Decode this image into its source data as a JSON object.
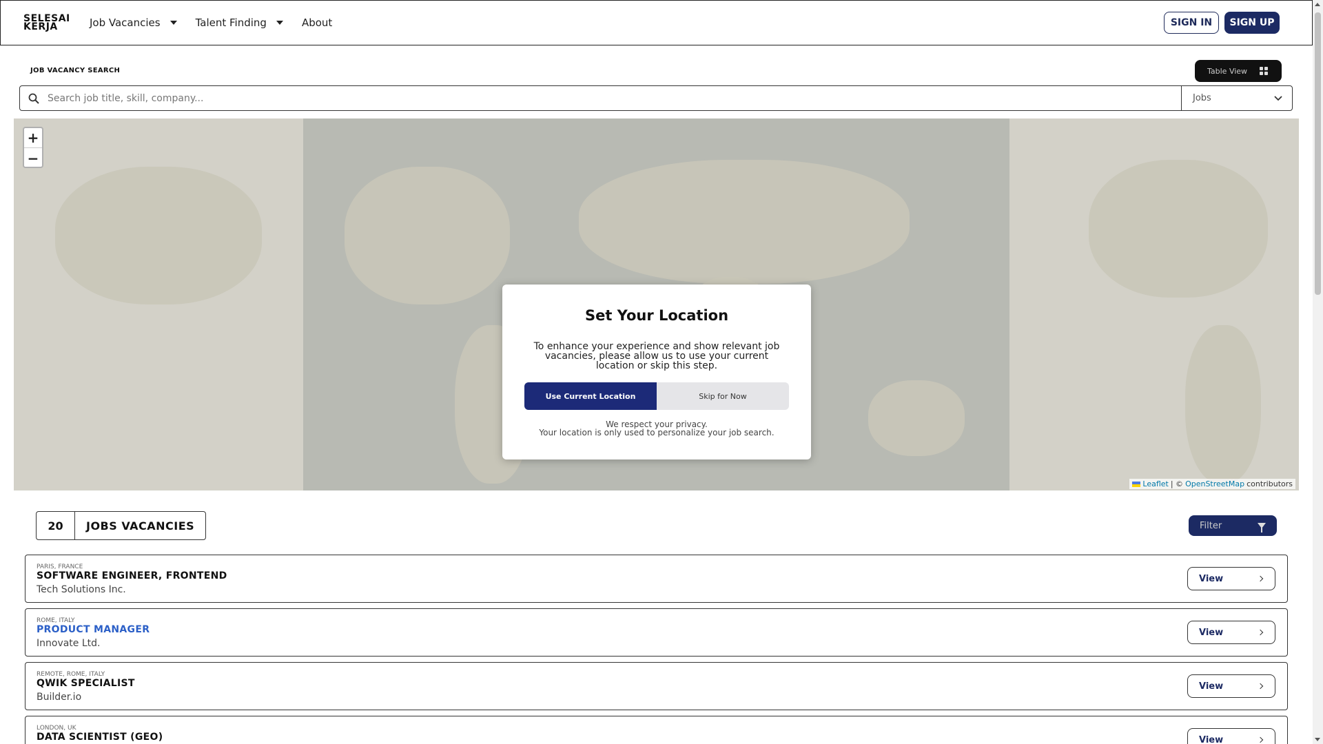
{
  "header": {
    "logo_line1": "SELESAI",
    "logo_line2": "KERJA",
    "nav": [
      {
        "label": "Job Vacancies",
        "dropdown": true
      },
      {
        "label": "Talent Finding",
        "dropdown": true
      },
      {
        "label": "About",
        "dropdown": false
      }
    ],
    "signin_label": "SIGN IN",
    "signup_label": "SIGN UP"
  },
  "search": {
    "section_title": "JOB VACANCY SEARCH",
    "table_view_label": "Table View",
    "placeholder": "Search job title, skill, company...",
    "category_value": "Jobs"
  },
  "map": {
    "zoom_in": "+",
    "zoom_out": "−",
    "attribution_leaflet": "Leaflet",
    "attribution_sep": "| ©",
    "attribution_osm": "OpenStreetMap",
    "attribution_suffix": "contributors"
  },
  "modal": {
    "title": "Set Your Location",
    "description": "To enhance your experience and show relevant job vacancies, please allow us to use your current location or skip this step.",
    "use_location_label": "Use Current Location",
    "skip_label": "Skip for Now",
    "privacy_line1": "We respect your privacy.",
    "privacy_line2": "Your location is only used to personalize your job search."
  },
  "results": {
    "count": "20",
    "label": "JOBS VACANCIES",
    "filter_label": "Filter"
  },
  "jobs": [
    {
      "location": "PARIS, FRANCE",
      "title": "SOFTWARE ENGINEER, FRONTEND",
      "company": "Tech Solutions Inc.",
      "view_label": "View",
      "title_color": "#111111"
    },
    {
      "location": "ROME, ITALY",
      "title": "PRODUCT MANAGER",
      "company": "Innovate Ltd.",
      "view_label": "View",
      "title_color": "#2b5fc7"
    },
    {
      "location": "REMOTE, ROME, ITALY",
      "title": "QWIK SPECIALIST",
      "company": "Builder.io",
      "view_label": "View",
      "title_color": "#111111"
    },
    {
      "location": "LONDON, UK",
      "title": "DATA SCIENTIST (GEO)",
      "company": "",
      "view_label": "View",
      "title_color": "#111111"
    }
  ]
}
